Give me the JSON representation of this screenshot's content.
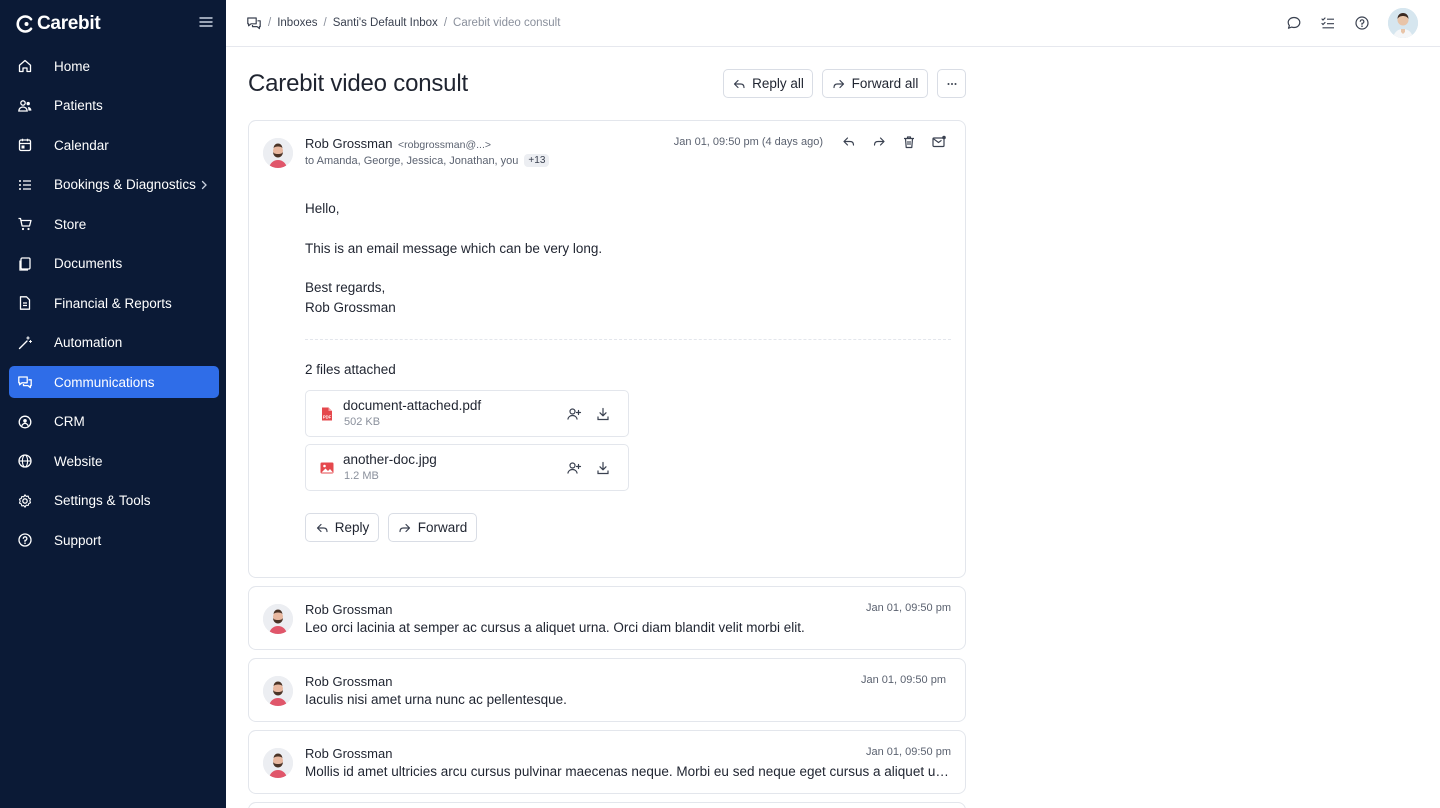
{
  "app": {
    "name": "Carebit"
  },
  "sidebar": {
    "items": [
      {
        "label": "Home",
        "icon": "home-icon"
      },
      {
        "label": "Patients",
        "icon": "users-icon"
      },
      {
        "label": "Calendar",
        "icon": "calendar-icon"
      },
      {
        "label": "Bookings & Diagnostics",
        "icon": "list-icon"
      },
      {
        "label": "Store",
        "icon": "cart-icon"
      },
      {
        "label": "Documents",
        "icon": "documents-icon"
      },
      {
        "label": "Financial & Reports",
        "icon": "report-icon"
      },
      {
        "label": "Automation",
        "icon": "magic-wand-icon"
      },
      {
        "label": "Communications",
        "icon": "chat-icon",
        "active": true
      },
      {
        "label": "CRM",
        "icon": "crm-icon"
      },
      {
        "label": "Website",
        "icon": "globe-icon"
      },
      {
        "label": "Settings & Tools",
        "icon": "gear-icon"
      },
      {
        "label": "Support",
        "icon": "help-icon"
      }
    ]
  },
  "breadcrumb": {
    "items": [
      "Inboxes",
      "Santi's Default Inbox",
      "Carebit video consult"
    ]
  },
  "page": {
    "title": "Carebit video consult",
    "reply_all": "Reply all",
    "forward_all": "Forward all"
  },
  "thread": {
    "expanded": {
      "sender": "Rob Grossman",
      "sender_email": "<robgrossman@...>",
      "recipients": "to Amanda, George, Jessica, Jonathan, you",
      "more_count": "+13",
      "timestamp": "Jan 01, 09:50 pm (4 days ago)",
      "greeting": "Hello,",
      "body": "This is an email message which can be very long.",
      "signoff": "Best regards,",
      "signature": "Rob Grossman",
      "files_title": "2 files attached",
      "files": [
        {
          "name": "document-attached.pdf",
          "size": "502 KB"
        },
        {
          "name": "another-doc.jpg",
          "size": "1.2 MB"
        }
      ],
      "reply_label": "Reply",
      "forward_label": "Forward"
    },
    "collapsed": [
      {
        "sender": "Rob Grossman",
        "timestamp": "Jan 01, 09:50 pm",
        "snippet": "Leo orci lacinia at semper ac cursus a aliquet urna. Orci diam blandit velit morbi elit."
      },
      {
        "sender": "Rob Grossman",
        "timestamp": "Jan 01, 09:50 pm",
        "snippet": "Iaculis nisi amet urna nunc ac pellentesque."
      },
      {
        "sender": "Rob Grossman",
        "timestamp": "Jan 01, 09:50 pm",
        "snippet": "Mollis id amet ultricies arcu cursus pulvinar maecenas neque. Morbi eu sed neque eget cursus a aliquet urna a..."
      }
    ]
  },
  "colors": {
    "sidebar_bg": "#0b1a36",
    "active_item": "#2f6de8",
    "pdf_red": "#e5484d"
  }
}
